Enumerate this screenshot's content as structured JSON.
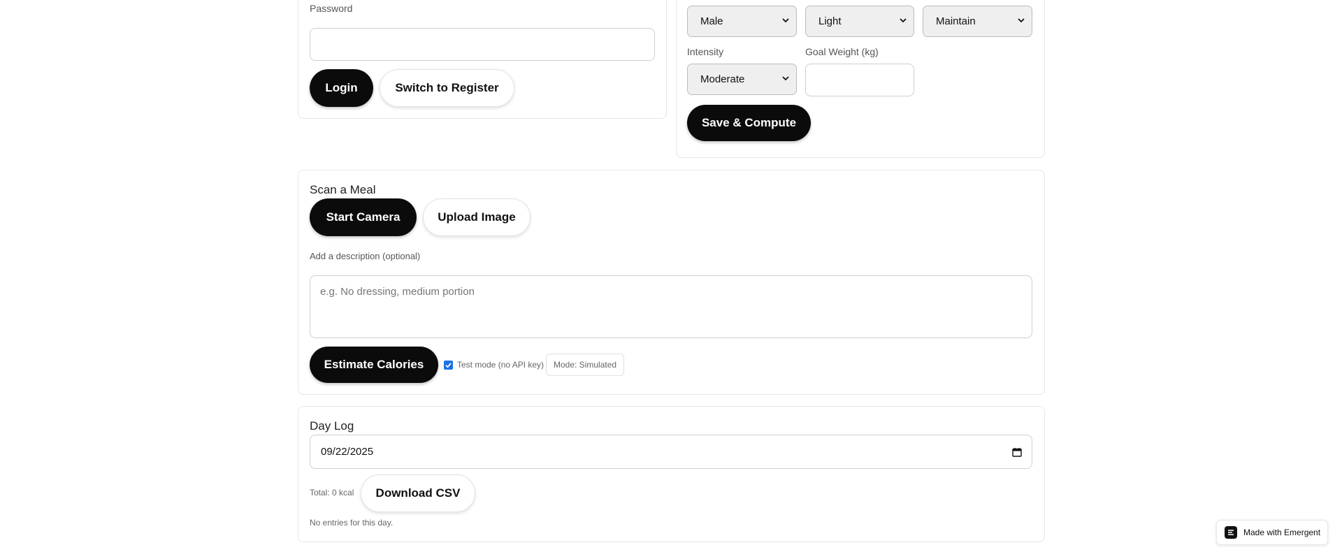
{
  "login": {
    "password_label": "Password",
    "password_value": "",
    "login_button": "Login",
    "switch_button": "Switch to Register"
  },
  "profile": {
    "sex_value": "Male",
    "activity_value": "Light",
    "goal_value": "Maintain",
    "intensity_label": "Intensity",
    "intensity_value": "Moderate",
    "goal_weight_label": "Goal Weight (kg)",
    "goal_weight_value": "",
    "save_button": "Save & Compute"
  },
  "scan": {
    "title": "Scan a Meal",
    "start_camera_button": "Start Camera",
    "upload_button": "Upload Image",
    "description_label": "Add a description (optional)",
    "description_placeholder": "e.g. No dressing, medium portion",
    "estimate_button": "Estimate Calories",
    "test_mode_label": "Test mode (no API key)",
    "test_mode_checked": true,
    "mode_badge": "Mode: Simulated"
  },
  "daylog": {
    "title": "Day Log",
    "date_value": "09/22/2025",
    "total_text": "Total: 0 kcal",
    "download_button": "Download CSV",
    "empty_text": "No entries for this day."
  },
  "badge": {
    "text": "Made with Emergent"
  },
  "colors": {
    "primary": "#0b0b0b",
    "accent_checkbox": "#1a73e8",
    "border": "#e6e6e6"
  }
}
